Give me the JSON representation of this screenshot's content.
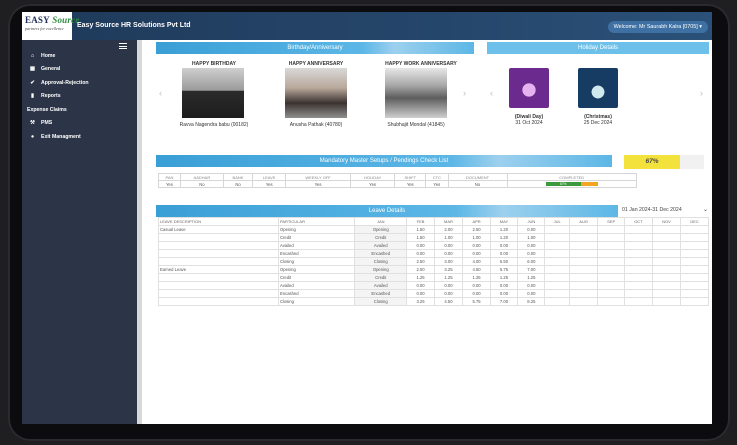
{
  "header": {
    "logo_main": "EASY",
    "logo_accent": "Source",
    "logo_tagline": "partners for excellence",
    "company": "Easy Source HR Solutions Pvt Ltd",
    "welcome": "Welcome: Mr Saurabh Kalra [0705]"
  },
  "sidebar": {
    "items": [
      {
        "label": "Home",
        "icon": "home-icon",
        "glyph": "⌂"
      },
      {
        "label": "General",
        "icon": "calendar-icon",
        "glyph": "▦"
      },
      {
        "label": "Approval-Rejection",
        "icon": "check-icon",
        "glyph": "✔"
      },
      {
        "label": "Reports",
        "icon": "document-icon",
        "glyph": "▮"
      },
      {
        "label": "Expense Claims",
        "icon": "",
        "glyph": ""
      },
      {
        "label": "PMS",
        "icon": "wrench-icon",
        "glyph": "⚒"
      },
      {
        "label": "Exit Managment",
        "icon": "user-icon",
        "glyph": "●"
      }
    ]
  },
  "birthday_panel": {
    "title": "Birthday/Anniversary",
    "cards": [
      {
        "heading": "HAPPY BIRTHDAY",
        "name": "Ravva Nagendra babu (00182)"
      },
      {
        "heading": "HAPPY ANNIVERSARY",
        "name": "Anusha Pathak (40780)"
      },
      {
        "heading": "HAPPY WORK ANNIVERSARY",
        "name": "Shubhajit Mondal (41845)"
      }
    ]
  },
  "holiday_panel": {
    "title": "Holiday Details",
    "items": [
      {
        "name": "(Diwali Day)",
        "date": "31 Oct 2024"
      },
      {
        "name": "(Christmas)",
        "date": "25 Dec 2024"
      }
    ]
  },
  "mandatory": {
    "title": "Mandatory Master Setups / Pendings Check List",
    "percent_label": "67%",
    "progress": 67,
    "columns": [
      "PAN",
      "AADHAR",
      "BANK",
      "LEAVE",
      "WEEKLY OFF",
      "HOLIDAY",
      "SHIFT",
      "CTC",
      "DOCUMENT",
      "COMPLETED"
    ],
    "values": [
      "Yes",
      "No",
      "No",
      "Yes",
      "Yes",
      "Yes",
      "Yes",
      "Yes",
      "No",
      "67%"
    ]
  },
  "leave": {
    "title": "Leave Details",
    "date_range": "01 Jan 2024-31 Dec 2024",
    "columns": [
      "LEAVE DESCRIPTION",
      "PARTICULAR",
      "JAN",
      "FEB",
      "MAR",
      "APR",
      "MAY",
      "JUN",
      "JUL",
      "AUG",
      "SEP",
      "OCT",
      "NOV",
      "DEC"
    ],
    "rows": [
      [
        "Casual Leave",
        "Opening",
        "Opening",
        "1.50",
        "2.00",
        "2.50",
        "1.20",
        "0.00",
        "",
        "",
        "",
        "",
        "",
        ""
      ],
      [
        "",
        "Credit",
        "Credit",
        "1.50",
        "1.00",
        "1.00",
        "1.20",
        "1.00",
        "",
        "",
        "",
        "",
        "",
        ""
      ],
      [
        "",
        "Availed",
        "Availed",
        "0.00",
        "0.00",
        "0.00",
        "0.00",
        "0.00",
        "",
        "",
        "",
        "",
        "",
        ""
      ],
      [
        "",
        "Encashed",
        "Encashed",
        "0.00",
        "0.00",
        "0.00",
        "0.00",
        "0.00",
        "",
        "",
        "",
        "",
        "",
        ""
      ],
      [
        "",
        "Closing",
        "Closing",
        "2.50",
        "3.00",
        "4.00",
        "5.50",
        "6.00",
        "",
        "",
        "",
        "",
        "",
        ""
      ],
      [
        "Earned Leave",
        "Opening",
        "Opening",
        "2.00",
        "3.25",
        "4.50",
        "5.75",
        "7.00",
        "",
        "",
        "",
        "",
        "",
        ""
      ],
      [
        "",
        "Credit",
        "Credit",
        "1.25",
        "1.25",
        "1.25",
        "1.25",
        "1.25",
        "",
        "",
        "",
        "",
        "",
        ""
      ],
      [
        "",
        "Availed",
        "Availed",
        "0.00",
        "0.00",
        "0.00",
        "0.00",
        "0.00",
        "",
        "",
        "",
        "",
        "",
        ""
      ],
      [
        "",
        "Encashed",
        "Encashed",
        "0.00",
        "0.00",
        "0.00",
        "0.00",
        "0.00",
        "",
        "",
        "",
        "",
        "",
        ""
      ],
      [
        "",
        "Closing",
        "Closing",
        "3.25",
        "4.50",
        "5.75",
        "7.00",
        "8.25",
        "",
        "",
        "",
        "",
        "",
        ""
      ]
    ]
  },
  "colors": {
    "topbar": "#25466b",
    "sidebar": "#2c3548",
    "panel_blue": "#3a9fd6",
    "progress_yellow": "#f3e23c",
    "progress_green": "#3c9a3c",
    "progress_orange": "#f3a623"
  }
}
